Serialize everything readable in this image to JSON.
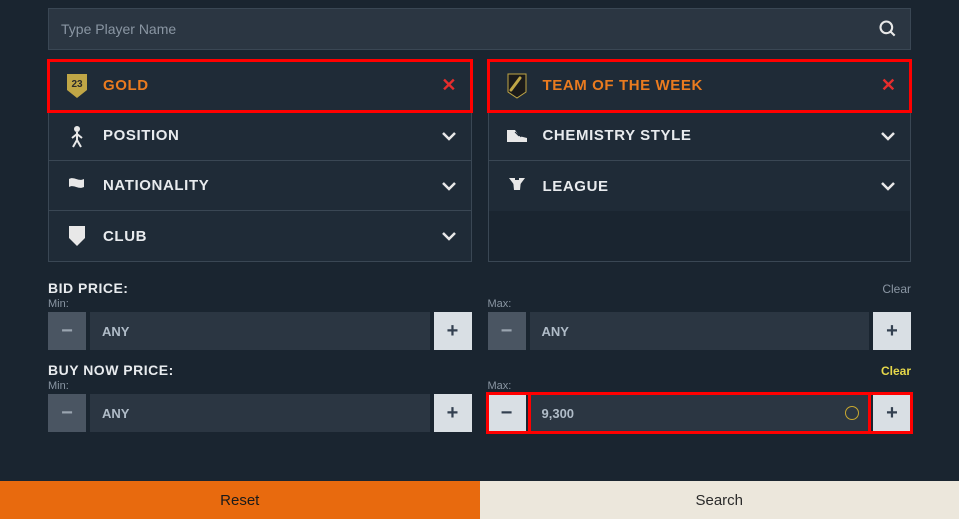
{
  "search": {
    "placeholder": "Type Player Name"
  },
  "filters": {
    "left": [
      {
        "key": "quality",
        "label": "GOLD",
        "active": true,
        "icon": "quality-badge-icon"
      },
      {
        "key": "position",
        "label": "POSITION",
        "active": false,
        "icon": "position-icon"
      },
      {
        "key": "nationality",
        "label": "NATIONALITY",
        "active": false,
        "icon": "nationality-icon"
      },
      {
        "key": "club",
        "label": "CLUB",
        "active": false,
        "icon": "club-shield-icon"
      }
    ],
    "right": [
      {
        "key": "rarity",
        "label": "TEAM OF THE WEEK",
        "active": true,
        "icon": "rarity-card-icon"
      },
      {
        "key": "chemstyle",
        "label": "CHEMISTRY STYLE",
        "active": false,
        "icon": "chemistry-boot-icon"
      },
      {
        "key": "league",
        "label": "LEAGUE",
        "active": false,
        "icon": "league-trophy-icon"
      }
    ]
  },
  "prices": {
    "bid": {
      "title": "BID PRICE:",
      "min_label": "Min:",
      "max_label": "Max:",
      "min_value": "ANY",
      "max_value": "ANY",
      "clear": "Clear",
      "clear_active": false
    },
    "buynow": {
      "title": "BUY NOW PRICE:",
      "min_label": "Min:",
      "max_label": "Max:",
      "min_value": "ANY",
      "max_value": "9,300",
      "clear": "Clear",
      "clear_active": true
    }
  },
  "footer": {
    "reset": "Reset",
    "search": "Search"
  }
}
